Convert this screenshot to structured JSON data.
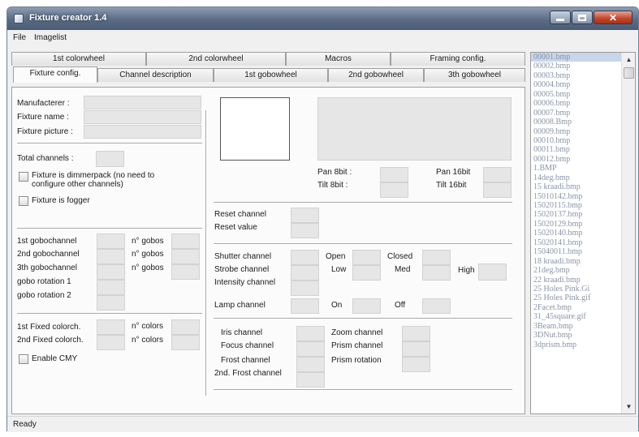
{
  "window": {
    "title": "Fixture creator 1.4"
  },
  "menu": [
    "File",
    "Imagelist"
  ],
  "tabs": {
    "row1": [
      "1st colorwheel",
      "2nd colorwheel",
      "Macros",
      "Framing config."
    ],
    "row2": [
      "Fixture config.",
      "Channel description",
      "1st gobowheel",
      "2nd gobowheel",
      "3th gobowheel"
    ],
    "selected": "Fixture config."
  },
  "fixture": {
    "manufacturer_label": "Manufacterer :",
    "name_label": "Fixture name :",
    "picture_label": "Fixture picture :",
    "total_channels_label": "Total channels :",
    "dimmerpack_label": "Fixture is dimmerpack (no need to configure other channels)",
    "dimmerpack_checked": false,
    "fogger_label": "Fixture is fogger",
    "fogger_checked": false
  },
  "gobos": {
    "gobo1_label": "1st gobochannel",
    "gobo2_label": "2nd gobochannel",
    "gobo3_label": "3th gobochannel",
    "rot1_label": "gobo rotation 1",
    "rot2_label": "gobo rotation 2",
    "n_gobos_label": "n° gobos"
  },
  "colors": {
    "fixed1_label": "1st Fixed colorch.",
    "fixed2_label": "2nd Fixed colorch.",
    "n_colors_label": "n° colors",
    "cmy_label": "Enable CMY",
    "cmy_checked": false
  },
  "pantilt": {
    "pan8_label": "Pan 8bit :",
    "tilt8_label": "Tilt 8bit :",
    "pan16_label": "Pan 16bit",
    "tilt16_label": "Tilt 16bit"
  },
  "reset": {
    "channel_label": "Reset channel",
    "value_label": "Reset value"
  },
  "shutter": {
    "shutter_label": "Shutter channel",
    "strobe_label": "Strobe channel",
    "intensity_label": "Intensity channel",
    "open_label": "Open",
    "closed_label": "Closed",
    "low_label": "Low",
    "med_label": "Med",
    "high_label": "High"
  },
  "lamp": {
    "channel_label": "Lamp channel",
    "on_label": "On",
    "off_label": "Off"
  },
  "optics": {
    "iris_label": "Iris channel",
    "focus_label": "Focus channel",
    "frost_label": "Frost channel",
    "frost2_label": "2nd. Frost channel",
    "zoom_label": "Zoom channel",
    "prism_label": "Prism channel",
    "prism_rot_label": "Prism rotation"
  },
  "imagelist": {
    "items": [
      "00001.bmp",
      "00002.bmp",
      "00003.bmp",
      "00004.bmp",
      "00005.bmp",
      "00006.bmp",
      "00007.bmp",
      "00008.Bmp",
      "00009.bmp",
      "00010.bmp",
      "00011.bmp",
      "00012.bmp",
      "1.BMP",
      "14deg.bmp",
      "15 kraadi.bmp",
      "15010142.bmp",
      "15020115.bmp",
      "15020137.bmp",
      "15020129.bmp",
      "15020140.bmp",
      "15020141.bmp",
      "15040011.bmp",
      "18 kraadi.bmp",
      "21deg.bmp",
      "22 kraadi.bmp",
      "25 Holes Pink.Gi",
      "25 Holes Pink.gif",
      "2Facet.bmp",
      "31_45square.gif",
      "3Beam.bmp",
      "3DNut.bmp",
      "3dprism.bmp"
    ],
    "selected_index": 0,
    "scroll_up_icon": "▲",
    "scroll_down_icon": "▼"
  },
  "status": {
    "text": "Ready"
  }
}
